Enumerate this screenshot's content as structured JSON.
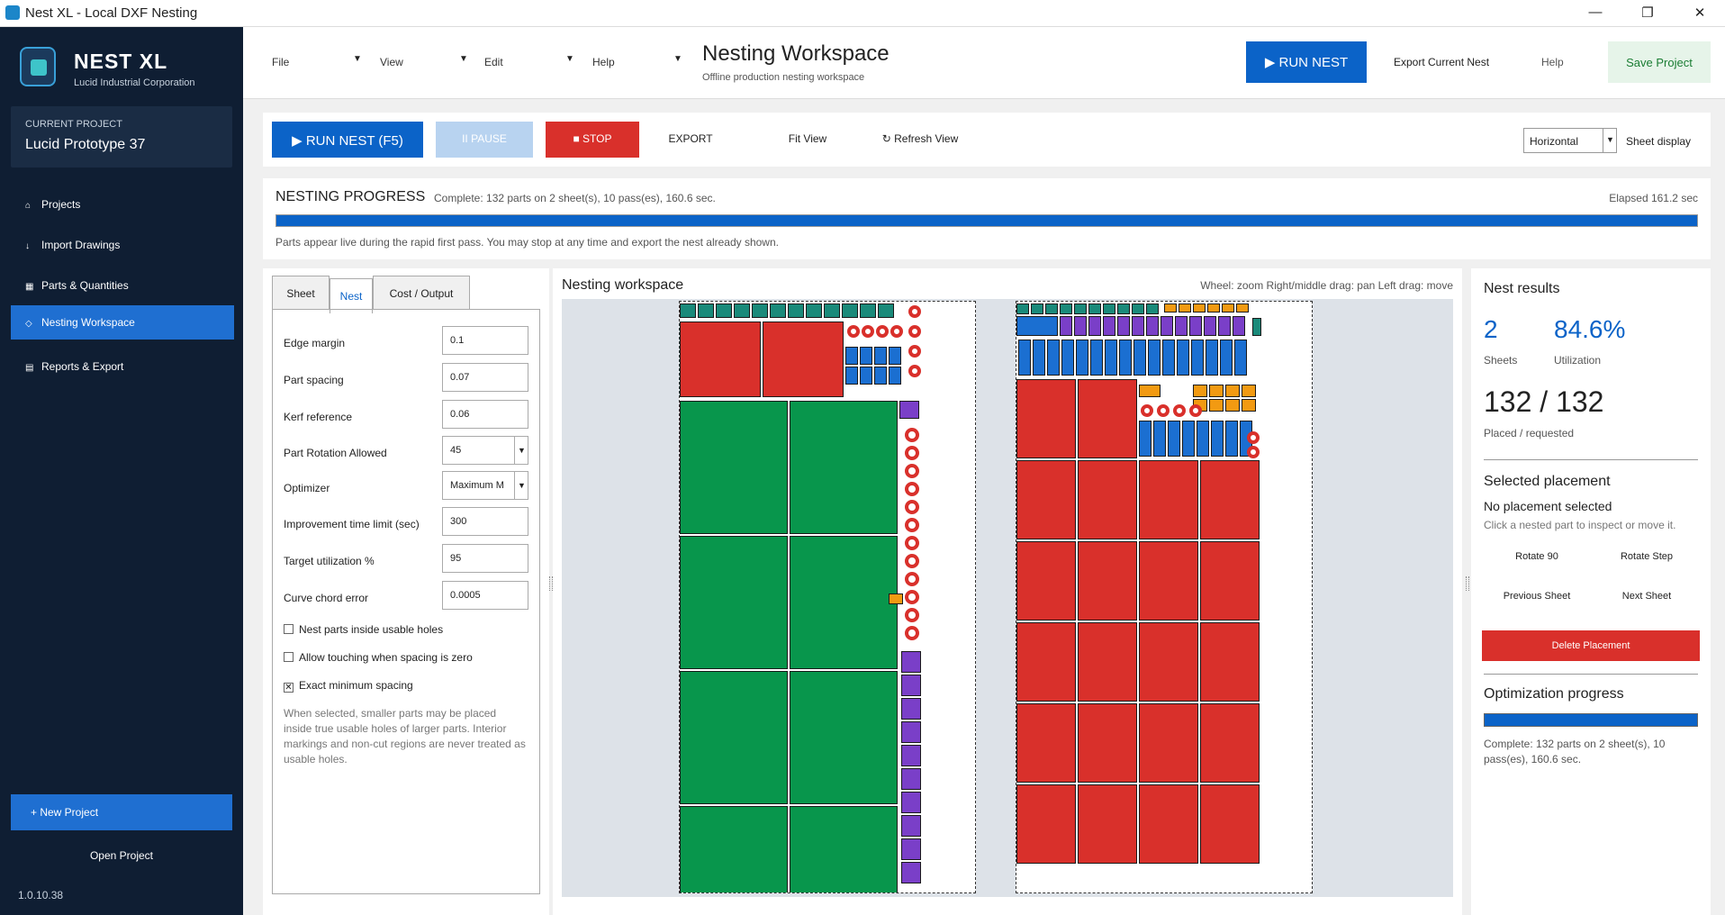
{
  "window": {
    "title": "Nest XL - Local DXF Nesting",
    "controls": [
      "—",
      "❐",
      "✕"
    ]
  },
  "sidebar": {
    "brand": "NEST XL",
    "brand_sub": "Lucid Industrial Corporation",
    "project_label": "CURRENT PROJECT",
    "project_name": "Lucid Prototype 37",
    "items": [
      {
        "icon": "⌂",
        "label": "Projects"
      },
      {
        "icon": "↓",
        "label": "Import Drawings"
      },
      {
        "icon": "▦",
        "label": "Parts & Quantities"
      },
      {
        "icon": "◇",
        "label": "Nesting Workspace",
        "active": true
      },
      {
        "icon": "▤",
        "label": "Reports & Export"
      }
    ],
    "new_project": "+  New Project",
    "open_project": "Open Project",
    "version": "1.0.10.38"
  },
  "header": {
    "menus": [
      "File",
      "View",
      "Edit",
      "Help"
    ],
    "title": "Nesting Workspace",
    "subtitle": "Offline production nesting workspace",
    "run_nest": "▶  RUN NEST",
    "export_current": "Export Current Nest",
    "help": "Help",
    "save_project": "Save Project"
  },
  "toolbar": {
    "run": "▶  RUN NEST  (F5)",
    "pause": "II  PAUSE",
    "stop": "■  STOP",
    "export": "EXPORT",
    "fit_view": "Fit View",
    "refresh_view": "↻  Refresh View",
    "orientation": "Horizontal",
    "sheet_display": "Sheet display"
  },
  "progress": {
    "title": "NESTING PROGRESS",
    "status": "Complete: 132 parts on 2 sheet(s), 10 pass(es), 160.6 sec.",
    "elapsed": "Elapsed 161.2 sec",
    "fraction": 1.0,
    "note": "Parts appear live during the rapid first pass. You may stop at any time and export the nest already shown."
  },
  "settings": {
    "tabs": [
      "Sheet",
      "Nest",
      "Cost / Output"
    ],
    "fields": [
      {
        "label": "Edge margin",
        "value": "0.1"
      },
      {
        "label": "Part spacing",
        "value": "0.07"
      },
      {
        "label": "Kerf reference",
        "value": "0.06"
      },
      {
        "label": "Part Rotation Allowed",
        "value": "45"
      },
      {
        "label": "Optimizer",
        "value": "Maximum M"
      },
      {
        "label": "Improvement time limit (sec)",
        "value": "300"
      },
      {
        "label": "Target utilization %",
        "value": "95"
      },
      {
        "label": "Curve chord error",
        "value": "0.0005"
      }
    ],
    "checks": [
      {
        "label": "Nest parts inside usable holes",
        "checked": false
      },
      {
        "label": "Allow touching when spacing is zero",
        "checked": false
      },
      {
        "label": "Exact minimum spacing",
        "checked": true
      }
    ],
    "help": "When selected, smaller parts may be placed inside true usable holes of larger parts. Interior markings and non-cut regions are never treated as usable holes."
  },
  "canvas": {
    "title": "Nesting workspace",
    "hints": "Wheel: zoom    Right/middle drag: pan    Left drag: move",
    "colors": {
      "red": "#d9302b",
      "green": "#08964c",
      "blue": "#1b6fd1",
      "purple": "#7a3fc8",
      "teal": "#1a8a7a",
      "orange": "#f29a12"
    }
  },
  "results": {
    "title": "Nest results",
    "sheets": "2",
    "sheets_label": "Sheets",
    "utilization": "84.6%",
    "utilization_label": "Utilization",
    "placed": "132 / 132",
    "placed_label": "Placed / requested",
    "selected_title": "Selected placement",
    "selected_none": "No placement selected",
    "selected_note": "Click a nested part to inspect or move it.",
    "rotate90": "Rotate 90",
    "rotate_step": "Rotate Step",
    "prev_sheet": "Previous Sheet",
    "next_sheet": "Next Sheet",
    "delete": "Delete Placement",
    "opt_title": "Optimization progress",
    "opt_fraction": 1.0,
    "opt_note": "Complete: 132 parts on 2 sheet(s), 10 pass(es), 160.6 sec."
  }
}
